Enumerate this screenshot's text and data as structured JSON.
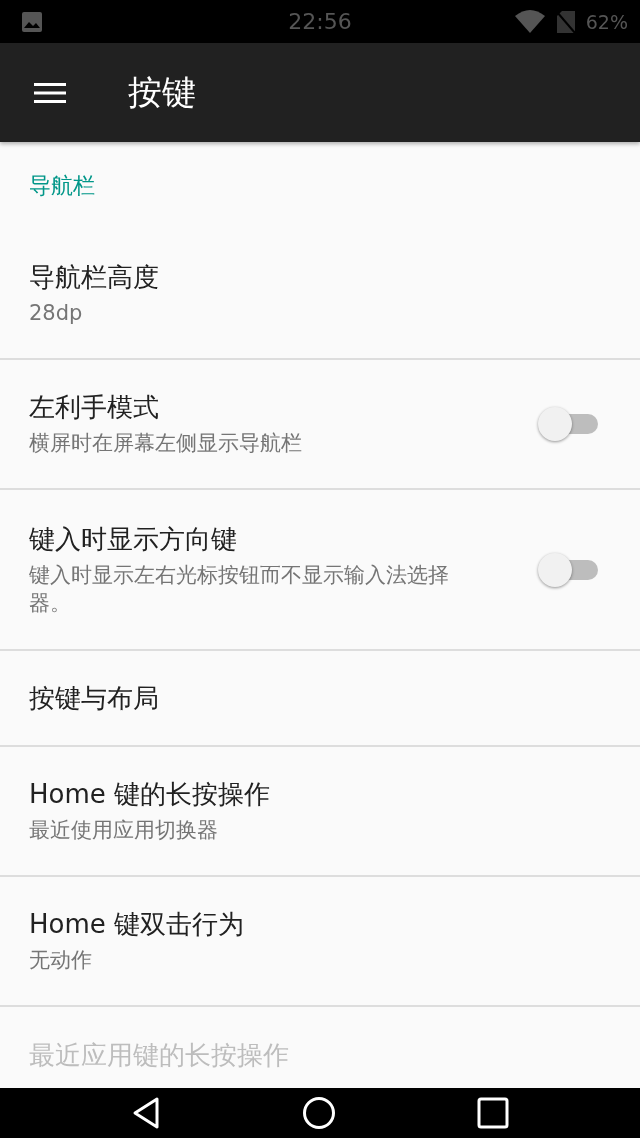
{
  "status_bar": {
    "time": "22:56",
    "battery": "62%"
  },
  "app_bar": {
    "title": "按键"
  },
  "category": {
    "title": "导航栏"
  },
  "items": [
    {
      "kind": "text",
      "title": "导航栏高度",
      "summary": "28dp",
      "disabled": false
    },
    {
      "kind": "switch",
      "title": "左利手模式",
      "summary": "横屏时在屏幕左侧显示导航栏",
      "checked": false,
      "disabled": false
    },
    {
      "kind": "switch",
      "title": "键入时显示方向键",
      "summary": "键入时显示左右光标按钮而不显示输入法选择器。",
      "checked": false,
      "disabled": false
    },
    {
      "kind": "text",
      "title": "按键与布局",
      "disabled": false
    },
    {
      "kind": "text",
      "title": "Home 键的长按操作",
      "summary": "最近使用应用切换器",
      "disabled": false
    },
    {
      "kind": "text",
      "title": "Home 键双击行为",
      "summary": "无动作",
      "disabled": false
    },
    {
      "kind": "text",
      "title": "最近应用键的长按操作",
      "disabled": true
    }
  ]
}
